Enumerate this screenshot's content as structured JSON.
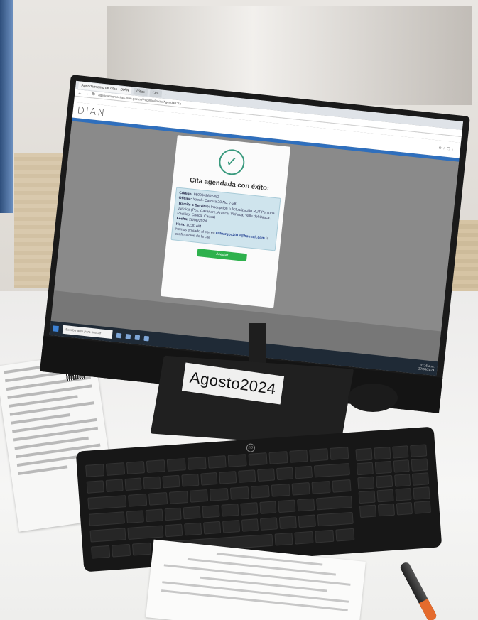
{
  "browser": {
    "tabs": [
      {
        "label": "Agendamiento de citas - DIAN",
        "active": true
      },
      {
        "label": "Citas",
        "active": false
      },
      {
        "label": "Cita",
        "active": false
      }
    ],
    "new_tab_symbol": "+",
    "url": "agendamientocitas.dian.gov.co/Paginas/Inicio/AgendarCita"
  },
  "site": {
    "logo_text": "DIAN",
    "accent_color": "#2f6fbd"
  },
  "modal": {
    "title": "Cita agendada con éxito:",
    "check_icon": "check-circle-icon",
    "fields": {
      "codigo_label": "Código:",
      "codigo_value": "9803049697452",
      "oficina_label": "Oficina:",
      "oficina_value": "Yopal - Carrera 20 No. 7-28",
      "tramite_label": "Trámite o Servicio:",
      "tramite_value": "Inscripción o Actualización RUT Persona Jurídica (Pbx: Casanare, Arauca, Vichada, Valle del Cauca, Pacífico, Chocó, Cauca)",
      "fecha_label": "Fecha:",
      "fecha_value": "28/08/2024",
      "hora_label": "Hora:",
      "hora_value": "10:30 AM",
      "email_note_prefix": "Hemos enviado al correo",
      "email": "cdluargos2019@hotmail.com",
      "email_note_suffix": "la confirmación de la cita"
    },
    "button_label": "Aceptar",
    "button_color": "#2eb14d"
  },
  "taskbar": {
    "search_placeholder": "Escribe aquí para buscar",
    "time": "10:16 a.m.",
    "date": "27/08/2024"
  },
  "stand_label": "Agosto2024",
  "monitor_brand": "hp"
}
